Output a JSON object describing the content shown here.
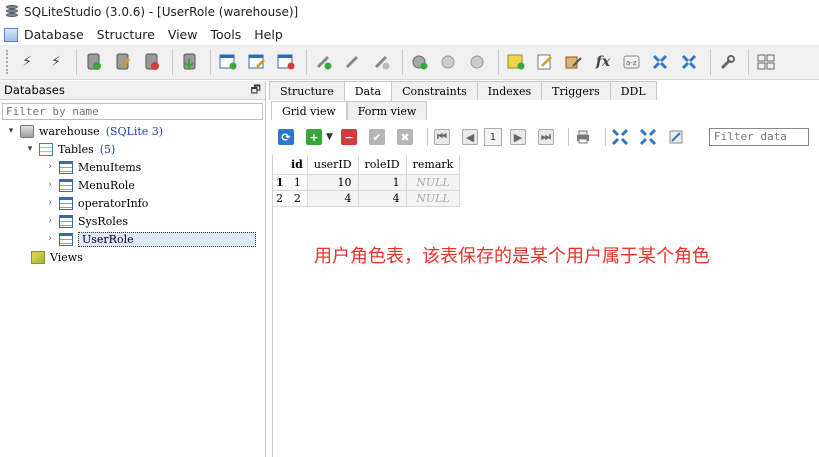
{
  "window": {
    "title": "SQLiteStudio (3.0.6) - [UserRole (warehouse)]"
  },
  "menu": {
    "items": [
      "Database",
      "Structure",
      "View",
      "Tools",
      "Help"
    ]
  },
  "databases_panel": {
    "title": "Databases",
    "filter_placeholder": "Filter by name",
    "database": {
      "name": "warehouse",
      "type": "(SQLite 3)"
    },
    "tables_label": "Tables",
    "tables_count": "(5)",
    "tables": [
      "MenuItems",
      "MenuRole",
      "operatorInfo",
      "SysRoles",
      "UserRole"
    ],
    "selected_table": "UserRole",
    "views_label": "Views"
  },
  "tabs": [
    "Structure",
    "Data",
    "Constraints",
    "Indexes",
    "Triggers",
    "DDL"
  ],
  "active_tab": "Data",
  "subtabs": [
    "Grid view",
    "Form view"
  ],
  "active_subtab": "Grid view",
  "grid_toolbar": {
    "page": "1",
    "filter_placeholder": "Filter data"
  },
  "grid": {
    "columns": [
      "id",
      "userID",
      "roleID",
      "remark"
    ],
    "rows": [
      {
        "num": "1",
        "id": "1",
        "userID": "10",
        "roleID": "1",
        "remark": "NULL"
      },
      {
        "num": "2",
        "id": "2",
        "userID": "4",
        "roleID": "4",
        "remark": "NULL"
      }
    ]
  },
  "annotation": "用户角色表，该表保存的是某个用户属于某个角色",
  "colors": {
    "annotation": "#e8332a",
    "link_blue": "#1c3fbf"
  }
}
